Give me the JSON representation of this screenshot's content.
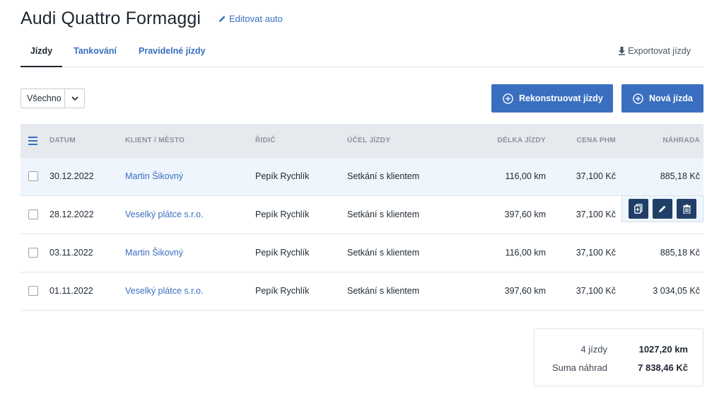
{
  "title": "Audi Quattro Formaggi",
  "edit_label": "Editovat auto",
  "tabs": [
    {
      "label": "Jízdy",
      "active": true
    },
    {
      "label": "Tankování",
      "active": false
    },
    {
      "label": "Pravidelné jízdy",
      "active": false
    }
  ],
  "export_label": "Exportovat jízdy",
  "filter": {
    "selected": "Všechno"
  },
  "buttons": {
    "reconstruct": "Rekonstruovat jízdy",
    "new": "Nová jízda"
  },
  "table": {
    "headers": {
      "date": "DATUM",
      "client": "KLIENT / MĚSTO",
      "driver": "ŘIDIČ",
      "purpose": "ÚČEL JÍZDY",
      "length": "DÉLKA JÍZDY",
      "fuel_price": "CENA PHM",
      "compensation": "NÁHRADA"
    },
    "rows": [
      {
        "date": "30.12.2022",
        "client": "Martin Šikovný",
        "driver": "Pepík Rychlík",
        "purpose": "Setkání s klientem",
        "length": "116,00 km",
        "fuel_price": "37,100 Kč",
        "compensation": "885,18 Kč"
      },
      {
        "date": "28.12.2022",
        "client": "Veselký plátce s.r.o.",
        "driver": "Pepík Rychlík",
        "purpose": "Setkání s klientem",
        "length": "397,60 km",
        "fuel_price": "37,100 Kč",
        "compensation": ""
      },
      {
        "date": "03.11.2022",
        "client": "Martin Šikovný",
        "driver": "Pepík Rychlík",
        "purpose": "Setkání s klientem",
        "length": "116,00 km",
        "fuel_price": "37,100 Kč",
        "compensation": "885,18 Kč"
      },
      {
        "date": "01.11.2022",
        "client": "Veselký plátce s.r.o.",
        "driver": "Pepík Rychlík",
        "purpose": "Setkání s klientem",
        "length": "397,60 km",
        "fuel_price": "37,100 Kč",
        "compensation": "3 034,05 Kč"
      }
    ]
  },
  "summary": {
    "count_label": "4 jízdy",
    "count_value": "1027,20 km",
    "sum_label": "Suma náhrad",
    "sum_value": "7 838,46 Kč"
  },
  "colors": {
    "accent": "#3a6fc0",
    "dark_action": "#1f3f66",
    "header_bg": "#e6e9ed",
    "highlight_row": "#eef5fc"
  },
  "icons": {
    "edit": "pencil-icon",
    "export": "download-icon",
    "add": "plus-circle-icon",
    "menu": "hamburger-icon",
    "copy": "copy-icon",
    "delete": "trash-icon"
  }
}
